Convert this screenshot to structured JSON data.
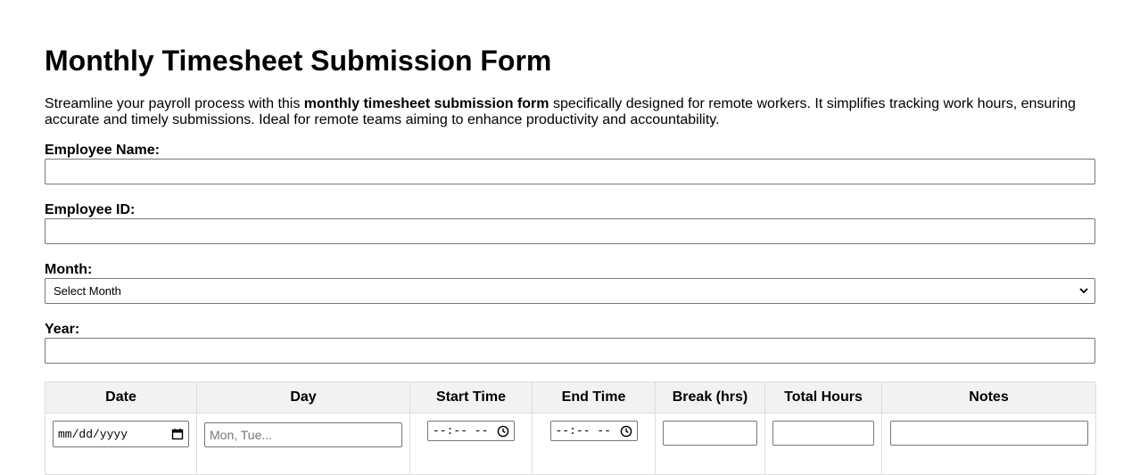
{
  "page": {
    "title": "Monthly Timesheet Submission Form",
    "description": {
      "before": "Streamline your payroll process with this ",
      "bold": "monthly timesheet submission form",
      "after": " specifically designed for remote workers. It simplifies tracking work hours, ensuring accurate and timely submissions. Ideal for remote teams aiming to enhance productivity and accountability."
    }
  },
  "form": {
    "employee_name_label": "Employee Name:",
    "employee_name_value": "",
    "employee_id_label": "Employee ID:",
    "employee_id_value": "",
    "month_label": "Month:",
    "month_selected": "Select Month",
    "year_label": "Year:",
    "year_value": ""
  },
  "table": {
    "headers": [
      "Date",
      "Day",
      "Start Time",
      "End Time",
      "Break (hrs)",
      "Total Hours",
      "Notes"
    ],
    "row": {
      "date_placeholder": "mm/dd/yyyy",
      "day_placeholder": "Mon, Tue...",
      "start_time_placeholder": "--:-- --",
      "end_time_placeholder": "--:-- --",
      "break_value": "",
      "total_hours_value": "",
      "notes_value": ""
    }
  },
  "icons": {
    "select_chevron": "chevron-down-icon",
    "date_picker": "calendar-icon",
    "time_picker": "clock-icon"
  }
}
